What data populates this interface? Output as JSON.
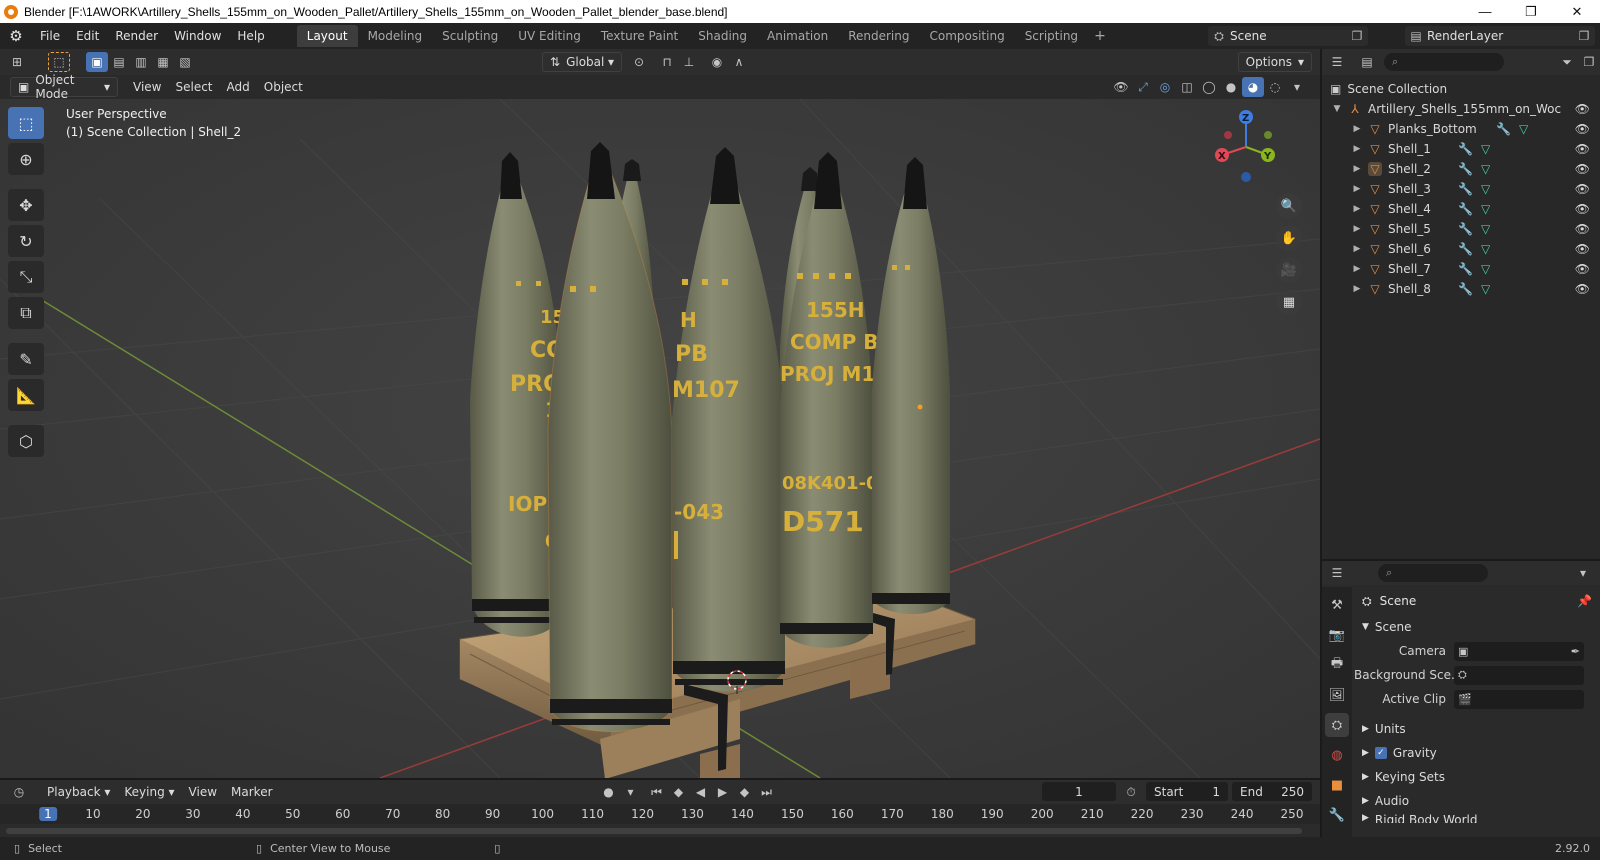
{
  "titlebar": {
    "title": "Blender [F:\\1AWORK\\Artillery_Shells_155mm_on_Wooden_Pallet/Artillery_Shells_155mm_on_Wooden_Pallet_blender_base.blend]",
    "minimize": "—",
    "maximize": "❐",
    "close": "✕"
  },
  "menu": [
    "File",
    "Edit",
    "Render",
    "Window",
    "Help"
  ],
  "workspaces": [
    "Layout",
    "Modeling",
    "Sculpting",
    "UV Editing",
    "Texture Paint",
    "Shading",
    "Animation",
    "Rendering",
    "Compositing",
    "Scripting"
  ],
  "workspace_plus": "+",
  "scene_selector": {
    "value": "Scene"
  },
  "renderlayer_selector": {
    "value": "RenderLayer"
  },
  "viewport": {
    "transform_orientation": "Global",
    "options_label": "Options",
    "mode": "Object Mode",
    "header_menus": [
      "View",
      "Select",
      "Add",
      "Object"
    ],
    "overlay_line1": "User Perspective",
    "overlay_line2": "(1) Scene Collection | Shell_2",
    "gizmo": {
      "x": "X",
      "y": "Y",
      "z": "Z"
    }
  },
  "outliner": {
    "search_placeholder": "",
    "root": "Scene Collection",
    "collection": "Artillery_Shells_155mm_on_Woc",
    "objects": [
      "Planks_Bottom",
      "Shell_1",
      "Shell_2",
      "Shell_3",
      "Shell_4",
      "Shell_5",
      "Shell_6",
      "Shell_7",
      "Shell_8"
    ],
    "selected": "Shell_2"
  },
  "properties": {
    "context_title": "Scene",
    "section_scene": "Scene",
    "camera_label": "Camera",
    "background_label": "Background Sce...",
    "active_clip_label": "Active Clip",
    "sections": [
      "Units",
      "Gravity",
      "Keying Sets",
      "Audio",
      "Rigid Body World"
    ],
    "gravity_checked": true
  },
  "timeline": {
    "menus": [
      "Playback",
      "Keying",
      "View",
      "Marker"
    ],
    "current_frame": "1",
    "start_label": "Start",
    "start_value": "1",
    "end_label": "End",
    "end_value": "250",
    "ruler": [
      "1",
      "10",
      "20",
      "30",
      "40",
      "50",
      "60",
      "70",
      "80",
      "90",
      "100",
      "110",
      "120",
      "130",
      "140",
      "150",
      "160",
      "170",
      "180",
      "190",
      "200",
      "210",
      "220",
      "230",
      "240",
      "250"
    ]
  },
  "statusbar": {
    "left": "Select",
    "middle": "Center View to Mouse",
    "version": "2.92.0"
  },
  "shell_markings": {
    "s1": [
      "155",
      "CO",
      "PRO",
      "107",
      "IOP",
      "043"
    ],
    "s3": [
      "H",
      "PB",
      "M107",
      "-043"
    ],
    "s5": [
      "155H",
      "COMP B",
      "PROJ  M107",
      "08K401-043",
      "D571"
    ]
  },
  "colors": {
    "accent": "#4772b3",
    "object_orange": "#e88e3c",
    "mesh_green": "#3cd29b",
    "shell_body": "#7d7f66",
    "shell_marking": "#d7b03c",
    "pallet_wood": "#b8976b"
  }
}
